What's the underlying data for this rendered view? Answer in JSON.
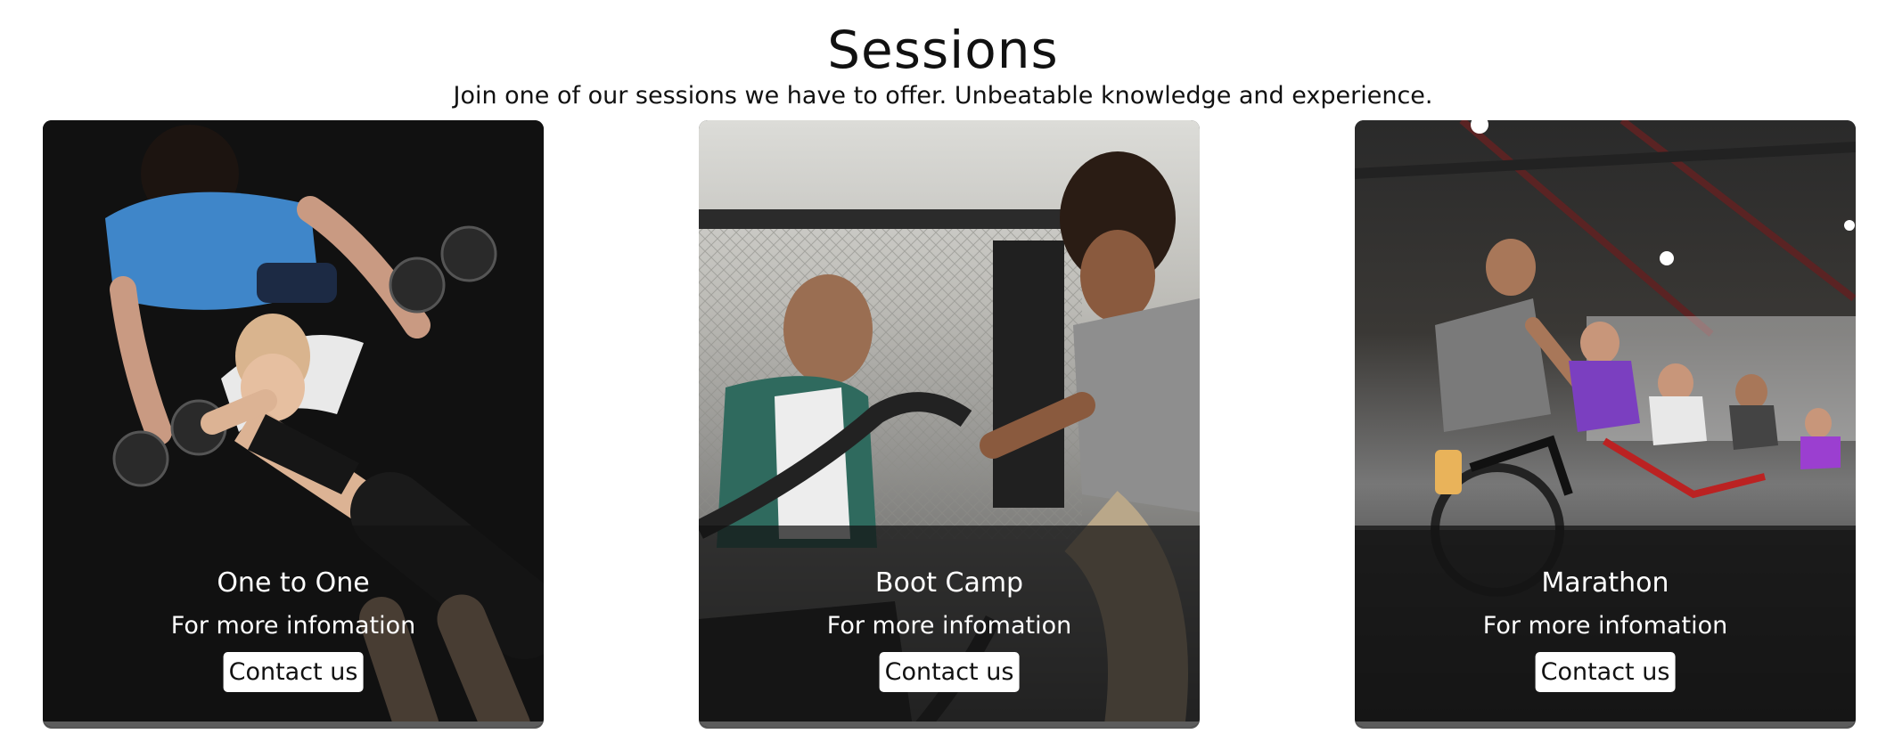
{
  "header": {
    "title": "Sessions",
    "subtitle": "Join one of our sessions we have to offer. Unbeatable knowledge and experience."
  },
  "cards": [
    {
      "name": "One to One",
      "info": "For more infomation",
      "button_label": "Contact us",
      "photo": "trainer-spotting-dumbbell-press-photo"
    },
    {
      "name": "Boot Camp",
      "info": "For more infomation",
      "button_label": "Contact us",
      "photo": "battle-ropes-training-photo"
    },
    {
      "name": "Marathon",
      "info": "For more infomation",
      "button_label": "Contact us",
      "photo": "indoor-cycling-class-photo"
    }
  ]
}
